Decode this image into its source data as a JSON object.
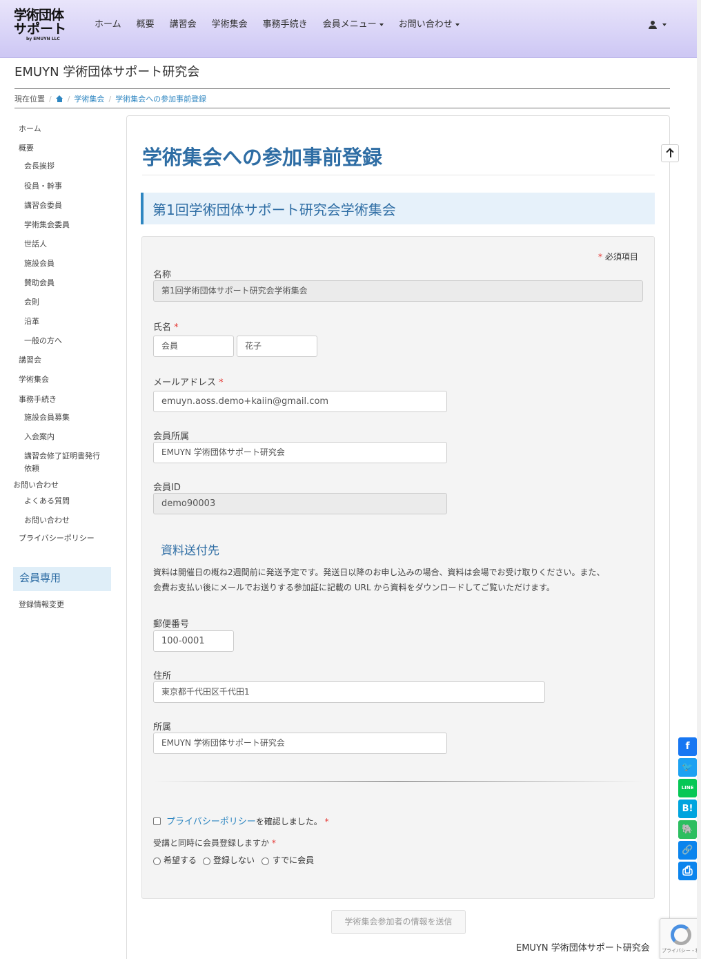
{
  "header": {
    "logo_line1": "学術団体",
    "logo_line2": "サポート",
    "logo_sub": "by EMUYN LLC",
    "nav": [
      {
        "label": "ホーム",
        "dropdown": false
      },
      {
        "label": "概要",
        "dropdown": false
      },
      {
        "label": "講習会",
        "dropdown": false
      },
      {
        "label": "学術集会",
        "dropdown": false
      },
      {
        "label": "事務手続き",
        "dropdown": false
      },
      {
        "label": "会員メニュー",
        "dropdown": true
      },
      {
        "label": "お問い合わせ",
        "dropdown": true
      }
    ]
  },
  "site_title": "EMUYN 学術団体サポート研究会",
  "breadcrumb": {
    "label": "現在位置",
    "items": [
      "学術集会",
      "学術集会への参加事前登録"
    ]
  },
  "sidebar": {
    "items": [
      {
        "label": "ホーム",
        "level": 0
      },
      {
        "label": "概要",
        "level": 0
      },
      {
        "label": "会長挨拶",
        "level": 1
      },
      {
        "label": "役員・幹事",
        "level": 1
      },
      {
        "label": "講習会委員",
        "level": 1
      },
      {
        "label": "学術集会委員",
        "level": 1
      },
      {
        "label": "世話人",
        "level": 1
      },
      {
        "label": "施設会員",
        "level": 1
      },
      {
        "label": "賛助会員",
        "level": 1
      },
      {
        "label": "会則",
        "level": 1
      },
      {
        "label": "沿革",
        "level": 1
      },
      {
        "label": "一般の方へ",
        "level": 1
      },
      {
        "label": "講習会",
        "level": 0
      },
      {
        "label": "学術集会",
        "level": 0
      },
      {
        "label": "事務手続き",
        "level": 0
      },
      {
        "label": "施設会員募集",
        "level": 1
      },
      {
        "label": "入会案内",
        "level": 1
      },
      {
        "label": "講習会修了証明書発行",
        "level": 1
      },
      {
        "label": "依頼",
        "level": 1
      },
      {
        "label": "お問い合わせ",
        "level": 0
      },
      {
        "label": "よくある質問",
        "level": 1
      },
      {
        "label": "お問い合わせ",
        "level": 1
      },
      {
        "label": "プライバシーポリシー",
        "level": 0
      }
    ],
    "members_heading": "会員専用",
    "members_items": [
      "登録情報変更"
    ]
  },
  "page": {
    "title": "学術集会への参加事前登録",
    "event_name": "第1回学術団体サポート研究会学術集会"
  },
  "form": {
    "required_mark": "*",
    "required_note": "必須項目",
    "event_label": "名称",
    "event_value": "第1回学術団体サポート研究会学術集会",
    "name_label": "氏名",
    "last_name": "会員",
    "first_name": "花子",
    "email_label": "メールアドレス",
    "email_value": "emuyn.aoss.demo+kaiin@gmail.com",
    "affiliation_label": "会員所属",
    "affiliation_value": "EMUYN 学術団体サポート研究会",
    "member_id_label": "会員ID",
    "member_id_value": "demo90003",
    "shipping_heading": "資料送付先",
    "shipping_notice_line1": "資料は開催日の概ね2週間前に発送予定です。発送日以降のお申し込みの場合、資料は会場でお受け取りください。また、",
    "shipping_notice_line2": "会費お支払い後にメールでお送りする参加証に記載の URL から資料をダウンロードしてご覧いただけます。",
    "postal_label": "郵便番号",
    "postal_value": "100-0001",
    "address_label": "住所",
    "address_value": "東京都千代田区千代田1",
    "org_label": "所属",
    "org_value": "EMUYN 学術団体サポート研究会",
    "privacy_link": "プライバシーポリシー",
    "privacy_suffix": "を確認しました。",
    "privacy_checked": false,
    "register_question": "受講と同時に会員登録しますか",
    "register_options": [
      "希望する",
      "登録しない",
      "すでに会員"
    ],
    "submit_label": "学術集会参加者の情報を送信"
  },
  "footer": {
    "site_name": "EMUYN 学術団体サポート研究会"
  },
  "share_buttons": [
    {
      "icon": "facebook-icon",
      "glyph": "f",
      "color": "#1877f2"
    },
    {
      "icon": "twitter-icon",
      "glyph": "🐦",
      "color": "#1da1f2"
    },
    {
      "icon": "line-icon",
      "glyph": "LINE",
      "color": "#06c755"
    },
    {
      "icon": "hatena-bookmark-icon",
      "glyph": "B!",
      "color": "#00a4de"
    },
    {
      "icon": "evernote-icon",
      "glyph": "🐘",
      "color": "#2dbe60"
    },
    {
      "icon": "copy-link-icon",
      "glyph": "🔗",
      "color": "#0b84ed"
    },
    {
      "icon": "print-icon",
      "glyph": "⎙",
      "color": "#0b84ed"
    }
  ],
  "recaptcha": {
    "text": "プライバシー・利用規約"
  }
}
